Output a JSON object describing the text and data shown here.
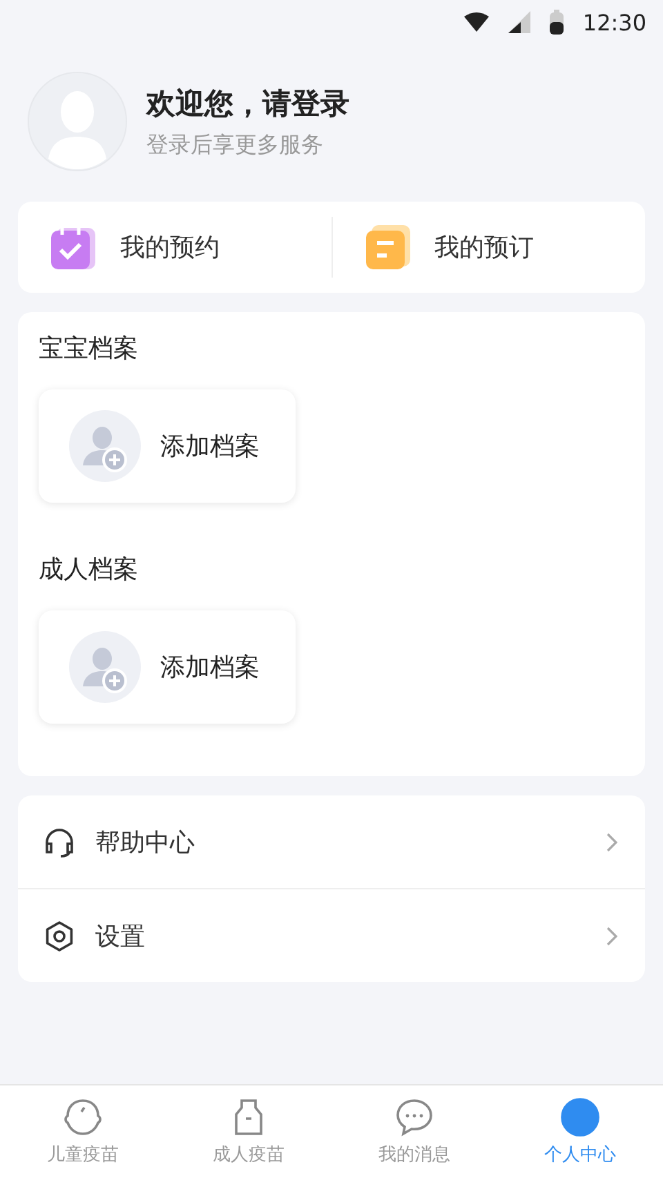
{
  "status_bar": {
    "time": "12:30"
  },
  "profile": {
    "title": "欢迎您，请登录",
    "subtitle": "登录后享更多服务"
  },
  "shortcuts": [
    {
      "kind": "appointment",
      "label": "我的预约"
    },
    {
      "kind": "order",
      "label": "我的预订"
    }
  ],
  "archives": [
    {
      "title": "宝宝档案",
      "action": "添加档案"
    },
    {
      "title": "成人档案",
      "action": "添加档案"
    }
  ],
  "menu": [
    {
      "kind": "help",
      "label": "帮助中心"
    },
    {
      "kind": "settings",
      "label": "设置"
    }
  ],
  "tabs": [
    {
      "kind": "child",
      "label": "儿童疫苗",
      "selected": false
    },
    {
      "kind": "adult",
      "label": "成人疫苗",
      "selected": false
    },
    {
      "kind": "message",
      "label": "我的消息",
      "selected": false
    },
    {
      "kind": "me",
      "label": "个人中心",
      "selected": true
    }
  ]
}
